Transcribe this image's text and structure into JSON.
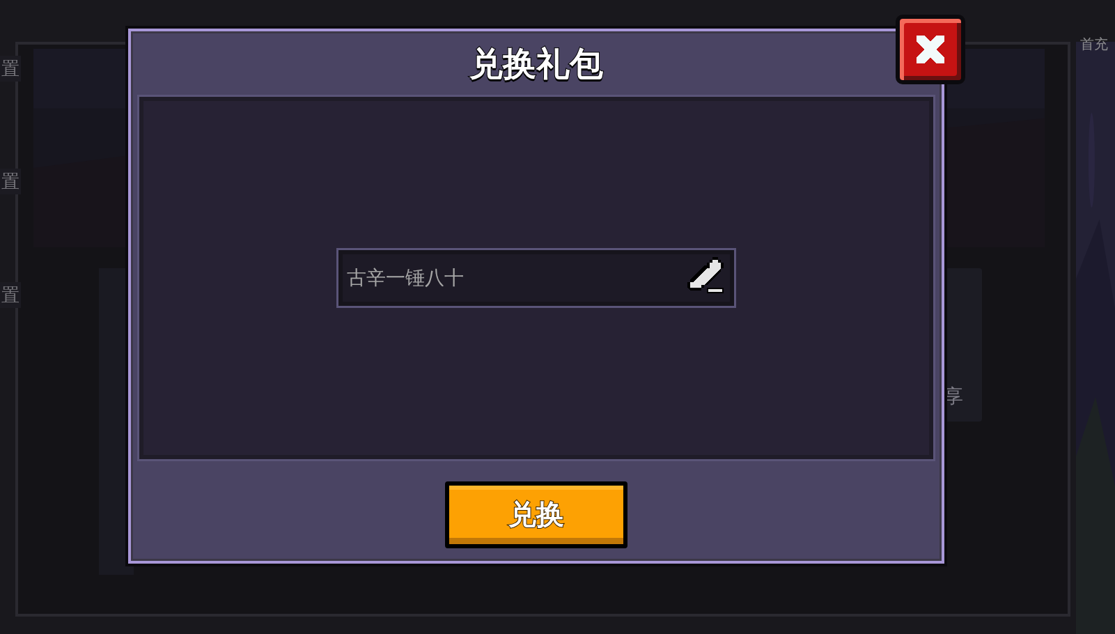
{
  "background": {
    "side_labels": [
      "置",
      "置",
      "置"
    ],
    "top_right_label": "首充",
    "right_label": "享"
  },
  "dialog": {
    "title": "兑换礼包",
    "code_field": {
      "value": "古辛一锤八十"
    },
    "submit_button": "兑换"
  }
}
